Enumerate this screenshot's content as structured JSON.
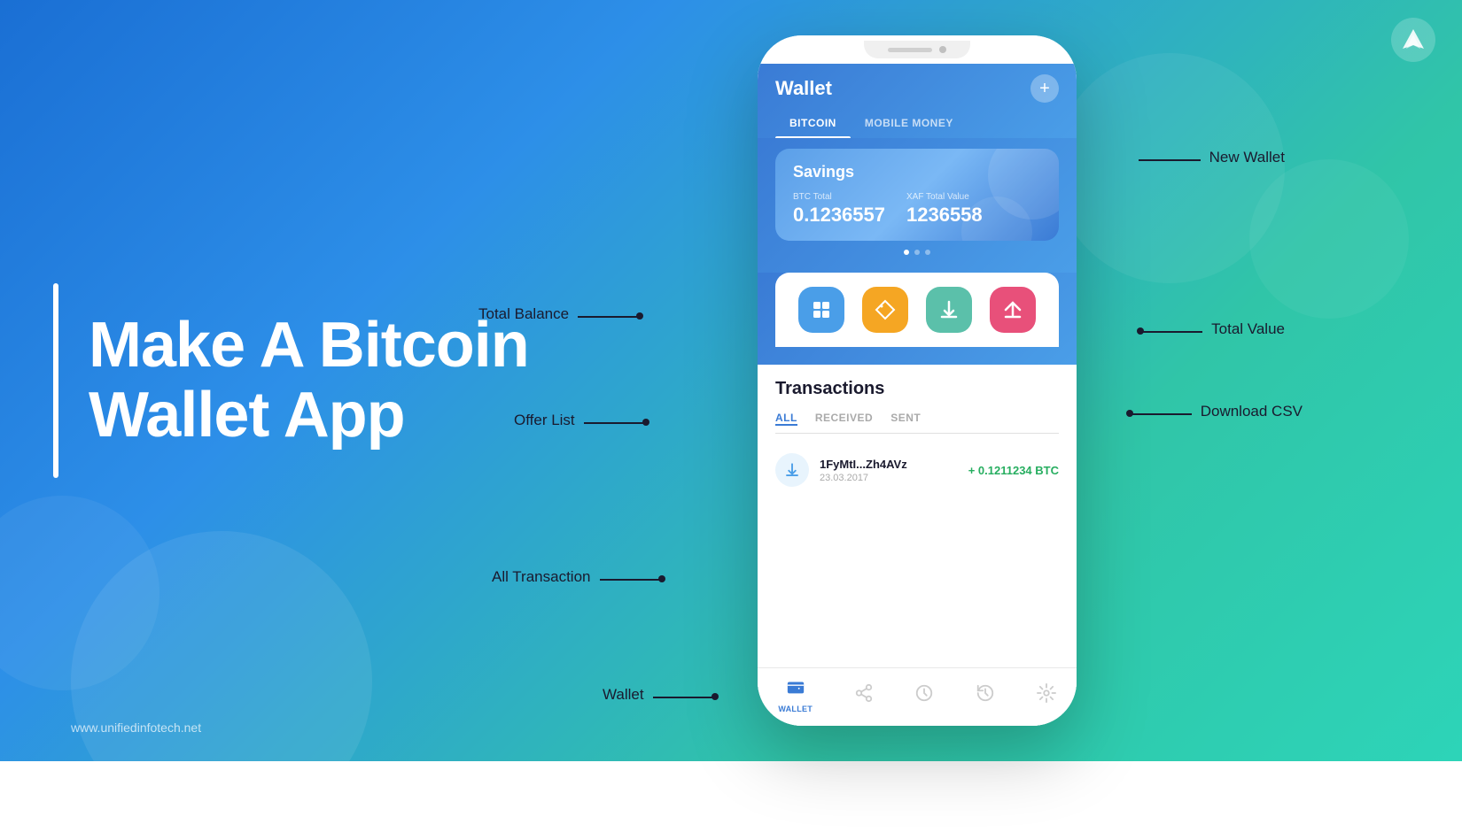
{
  "background": {
    "gradient_start": "#1a6fd4",
    "gradient_end": "#2dd4b8"
  },
  "logo": {
    "symbol": "U",
    "aria": "Unified Infotech Logo"
  },
  "left_panel": {
    "heading_line1": "Make A Bitcoin",
    "heading_line2": "Wallet App",
    "website": "www.unifiedinfotech.net"
  },
  "phone": {
    "header": {
      "title": "Wallet",
      "plus_button": "+",
      "tabs": [
        {
          "label": "BITCOIN",
          "active": true
        },
        {
          "label": "MOBILE MONEY",
          "active": false
        }
      ]
    },
    "wallet_card": {
      "name": "Savings",
      "btc_label": "BTC Total",
      "btc_value": "0.1236557",
      "xaf_label": "XAF Total Value",
      "xaf_value": "1236558",
      "dots": [
        {
          "active": true
        },
        {
          "active": false
        },
        {
          "active": false
        }
      ]
    },
    "action_buttons": [
      {
        "icon": "🛒",
        "color": "blue",
        "label": "Offer List"
      },
      {
        "icon": "🏷️",
        "color": "orange",
        "label": "Tag"
      },
      {
        "icon": "📥",
        "color": "green",
        "label": "Download CSV"
      },
      {
        "icon": "↗",
        "color": "pink",
        "label": "Share"
      }
    ],
    "transactions": {
      "title": "Transactions",
      "tabs": [
        {
          "label": "ALL",
          "active": true
        },
        {
          "label": "RECEIVED",
          "active": false
        },
        {
          "label": "SENT",
          "active": false
        }
      ],
      "items": [
        {
          "address": "1FyMtI...Zh4AVz",
          "date": "23.03.2017",
          "amount": "+ 0.1211234 BTC"
        }
      ]
    },
    "bottom_nav": [
      {
        "icon": "👛",
        "label": "WALLET",
        "active": true
      },
      {
        "icon": "↗",
        "label": "",
        "active": false
      },
      {
        "icon": "⏱",
        "label": "",
        "active": false
      },
      {
        "icon": "🕐",
        "label": "",
        "active": false
      },
      {
        "icon": "⚙",
        "label": "",
        "active": false
      }
    ]
  },
  "annotations": {
    "new_wallet": "New Wallet",
    "total_balance": "Total Balance",
    "total_value": "Total Value",
    "offer_list": "Offer List",
    "download_csv": "Download CSV",
    "all_transaction": "All Transaction",
    "wallet": "Wallet"
  }
}
